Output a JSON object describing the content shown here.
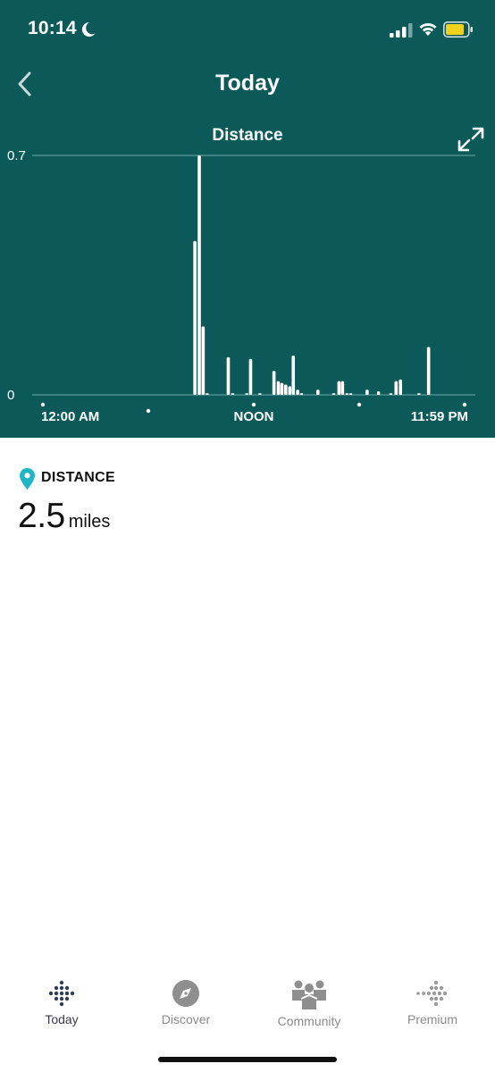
{
  "status_bar": {
    "time": "10:14",
    "icons": [
      "moon-icon",
      "cellular-signal-icon",
      "wifi-icon",
      "battery-icon"
    ],
    "battery_color": "#f0d21c"
  },
  "header": {
    "title": "Today",
    "back_icon": "chevron-left-icon",
    "background": "#0b5a59"
  },
  "chart": {
    "title": "Distance",
    "expand_icon": "expand-icon"
  },
  "chart_data": {
    "type": "bar",
    "title": "Distance",
    "ylim": [
      0,
      0.7
    ],
    "y_ticks": [
      "0.7",
      "0"
    ],
    "x_tick_labels": [
      "12:00 AM",
      "NOON",
      "11:59 PM"
    ],
    "x_unit": "hours since midnight",
    "bars": [
      {
        "t": 8.65,
        "v": 0.45
      },
      {
        "t": 8.9,
        "v": 0.7
      },
      {
        "t": 9.12,
        "v": 0.2
      },
      {
        "t": 9.35,
        "v": 0.005
      },
      {
        "t": 10.55,
        "v": 0.11
      },
      {
        "t": 10.8,
        "v": 0.005
      },
      {
        "t": 11.6,
        "v": 0.005
      },
      {
        "t": 11.82,
        "v": 0.105
      },
      {
        "t": 12.35,
        "v": 0.005
      },
      {
        "t": 13.15,
        "v": 0.07
      },
      {
        "t": 13.4,
        "v": 0.04
      },
      {
        "t": 13.6,
        "v": 0.035
      },
      {
        "t": 13.82,
        "v": 0.03
      },
      {
        "t": 14.05,
        "v": 0.025
      },
      {
        "t": 14.25,
        "v": 0.115
      },
      {
        "t": 14.5,
        "v": 0.015
      },
      {
        "t": 14.72,
        "v": 0.005
      },
      {
        "t": 15.65,
        "v": 0.015
      },
      {
        "t": 16.55,
        "v": 0.005
      },
      {
        "t": 16.85,
        "v": 0.04
      },
      {
        "t": 17.05,
        "v": 0.04
      },
      {
        "t": 17.3,
        "v": 0.005
      },
      {
        "t": 17.52,
        "v": 0.005
      },
      {
        "t": 18.45,
        "v": 0.015
      },
      {
        "t": 19.1,
        "v": 0.01
      },
      {
        "t": 19.8,
        "v": 0.005
      },
      {
        "t": 20.1,
        "v": 0.04
      },
      {
        "t": 20.35,
        "v": 0.045
      },
      {
        "t": 21.4,
        "v": 0.005
      },
      {
        "t": 21.95,
        "v": 0.14
      }
    ],
    "hour_dots": [
      0,
      6,
      12,
      18,
      24
    ]
  },
  "metric": {
    "label": "DISTANCE",
    "value": "2.5",
    "unit": "miles",
    "pin_color": "#1fb5c4"
  },
  "tabs": [
    {
      "label": "Today",
      "icon": "fitbit-dots-icon",
      "active": true
    },
    {
      "label": "Discover",
      "icon": "compass-icon",
      "active": false
    },
    {
      "label": "Community",
      "icon": "community-icon",
      "active": false
    },
    {
      "label": "Premium",
      "icon": "premium-icon",
      "active": false
    }
  ]
}
